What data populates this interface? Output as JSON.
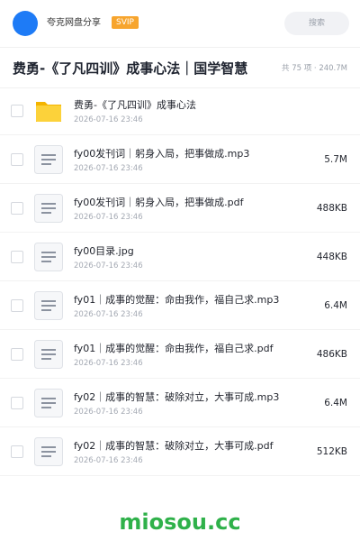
{
  "header": {
    "sharer_name": "夸克网盘分享",
    "badge": "SVIP",
    "search_placeholder": "搜索"
  },
  "title": "费勇-《了凡四训》成事心法｜国学智慧",
  "summary": "共 75 项 · 240.7M",
  "files": [
    {
      "name": "费勇-《了凡四训》成事心法",
      "date": "2026-07-16 23:46",
      "size": "",
      "type": "folder"
    },
    {
      "name": "fy00发刊词｜躬身入局，把事做成.mp3",
      "date": "2026-07-16 23:46",
      "size": "5.7M",
      "type": "file"
    },
    {
      "name": "fy00发刊词｜躬身入局，把事做成.pdf",
      "date": "2026-07-16 23:46",
      "size": "488KB",
      "type": "file"
    },
    {
      "name": "fy00目录.jpg",
      "date": "2026-07-16 23:46",
      "size": "448KB",
      "type": "file"
    },
    {
      "name": "fy01｜成事的觉醒：命由我作，福自己求.mp3",
      "date": "2026-07-16 23:46",
      "size": "6.4M",
      "type": "file"
    },
    {
      "name": "fy01｜成事的觉醒：命由我作，福自己求.pdf",
      "date": "2026-07-16 23:46",
      "size": "486KB",
      "type": "file"
    },
    {
      "name": "fy02｜成事的智慧：破除对立，大事可成.mp3",
      "date": "2026-07-16 23:46",
      "size": "6.4M",
      "type": "file"
    },
    {
      "name": "fy02｜成事的智慧：破除对立，大事可成.pdf",
      "date": "2026-07-16 23:46",
      "size": "512KB",
      "type": "file"
    }
  ],
  "watermark": "miosou.cc",
  "colors": {
    "accent": "#1e7bf6",
    "svip": "#f7a52e",
    "folder": "#fbc02d",
    "watermark": "#2fb14a"
  }
}
